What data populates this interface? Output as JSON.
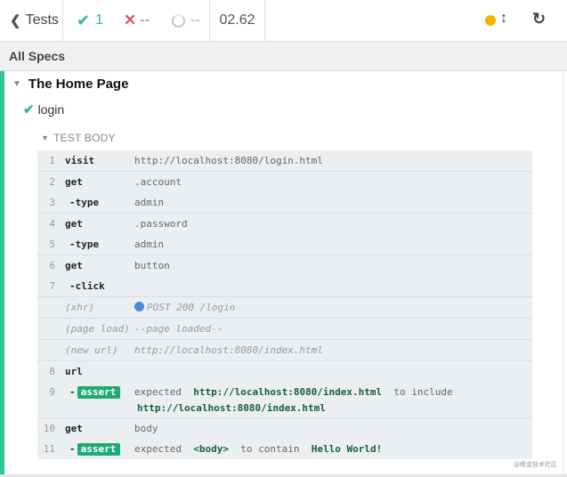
{
  "toolbar": {
    "back_label": "Tests",
    "passed": "1",
    "failed": "--",
    "pending": "--",
    "duration": "02.62"
  },
  "specs_header": "All Specs",
  "suite": {
    "title": "The Home Page"
  },
  "test": {
    "title": "login"
  },
  "section": {
    "title": "TEST BODY"
  },
  "commands": {
    "r1": {
      "num": "1",
      "name": "visit",
      "msg": "http://localhost:8080/login.html"
    },
    "r2": {
      "num": "2",
      "name": "get",
      "msg": ".account"
    },
    "r3": {
      "num": "3",
      "name": "-type",
      "msg": "admin"
    },
    "r4": {
      "num": "4",
      "name": "get",
      "msg": ".password"
    },
    "r5": {
      "num": "5",
      "name": "-type",
      "msg": "admin"
    },
    "r6": {
      "num": "6",
      "name": "get",
      "msg": "button"
    },
    "r7": {
      "num": "7",
      "name": "-click"
    },
    "xhr": {
      "name": "(xhr)",
      "msg": "POST 200 /login"
    },
    "page_load": {
      "name": "(page load)",
      "msg": "--page loaded--"
    },
    "new_url": {
      "name": "(new url)",
      "msg": "http://localhost:8080/index.html"
    },
    "r8": {
      "num": "8",
      "name": "url"
    },
    "r9": {
      "num": "9",
      "badge": "assert",
      "expected": "expected",
      "value": "http://localhost:8080/index.html",
      "verb": "to include",
      "target": "http://localhost:8080/index.html"
    },
    "r10": {
      "num": "10",
      "name": "get",
      "msg": "body"
    },
    "r11": {
      "num": "11",
      "badge": "assert",
      "expected": "expected",
      "value": "<body>",
      "verb": "to contain",
      "target": "Hello World!"
    }
  },
  "watermark": "@稀金技术社区",
  "colors": {
    "pass": "#31ba84",
    "fail": "#e05757",
    "running": "#f4b400",
    "xhr": "#4a8bd4",
    "assert_badge": "#1faa74"
  },
  "icons": {
    "back": "chevron-left-icon",
    "pass": "check-icon",
    "fail": "x-icon",
    "pending": "spinner-icon",
    "status": "status-dot-icon",
    "scroll": "up-down-arrow-icon",
    "reload": "reload-icon"
  }
}
